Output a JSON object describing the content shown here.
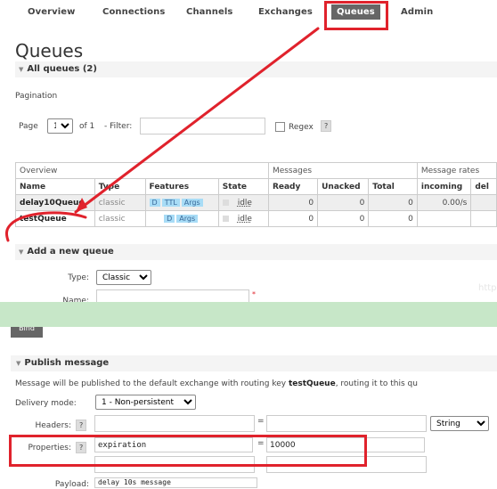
{
  "nav": {
    "items": [
      "Overview",
      "Connections",
      "Channels",
      "Exchanges",
      "Queues",
      "Admin"
    ],
    "active": "Queues"
  },
  "page_title": "Queues",
  "all_queues_label": "All queues (2)",
  "pagination": {
    "title": "Pagination",
    "page_label": "Page",
    "page_value": "1",
    "of_label": "of 1",
    "filter_label": "- Filter:",
    "filter_value": "",
    "regex_label": "Regex",
    "help": "?"
  },
  "table": {
    "group_overview": "Overview",
    "group_messages": "Messages",
    "group_rates": "Message rates",
    "headers": [
      "Name",
      "Type",
      "Features",
      "State",
      "Ready",
      "Unacked",
      "Total",
      "incoming",
      "del"
    ],
    "rows": [
      {
        "name": "delay10Queue",
        "type": "classic",
        "features": [
          "D",
          "TTL",
          "Args"
        ],
        "state": "idle",
        "ready": "0",
        "unacked": "0",
        "total": "0",
        "incoming": "0.00/s"
      },
      {
        "name": "testQueue",
        "type": "classic",
        "features": [
          "D",
          "Args"
        ],
        "state": "idle",
        "ready": "0",
        "unacked": "0",
        "total": "0",
        "incoming": ""
      }
    ]
  },
  "add_queue": {
    "title": "Add a new queue",
    "type_label": "Type:",
    "type_value": "Classic",
    "name_label": "Name:",
    "required_mark": "*",
    "watermark": "http",
    "bind_label": "Bind"
  },
  "publish": {
    "title": "Publish message",
    "info_text_prefix": "Message will be published to the default exchange with routing key ",
    "info_routing_key": "testQueue",
    "info_text_suffix": ", routing it to this qu",
    "delivery_mode_label": "Delivery mode:",
    "delivery_mode_value": "1 - Non-persistent",
    "headers_label": "Headers:",
    "header_type": "String",
    "properties_label": "Properties:",
    "property_key": "expiration",
    "property_value": "10000",
    "equals": "=",
    "help": "?",
    "payload_label": "Payload:",
    "payload_value": "delay 10s message"
  },
  "colors": {
    "highlight": "#e0222c",
    "tag_blue": "#a8dcf6",
    "banner_green": "#c7e7c8",
    "nav_active": "#666666"
  }
}
